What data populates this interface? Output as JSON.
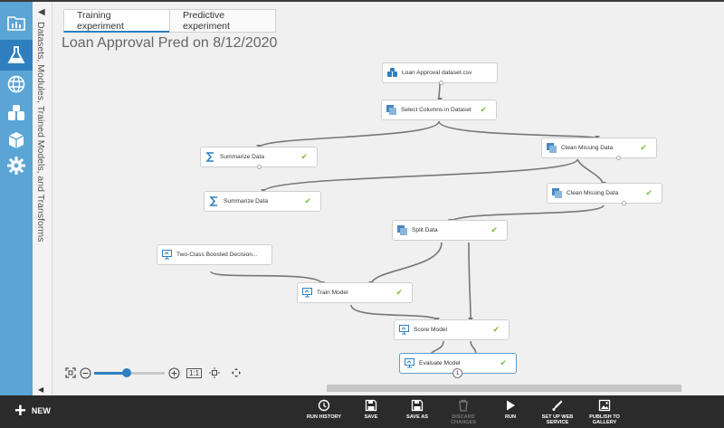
{
  "tabs": [
    {
      "label": "Training experiment",
      "active": true
    },
    {
      "label": "Predictive experiment",
      "active": false
    }
  ],
  "palette_label": "Datasets, Modules, Trained Models, and Transforms",
  "title": "Loan Approval Pred on 8/12/2020",
  "nodes": {
    "dataset": {
      "label": "Loan Approval dataset.csv",
      "icon": "dataset-icon"
    },
    "select_columns": {
      "label": "Select Columns in Dataset",
      "icon": "module-icon"
    },
    "summarize_1": {
      "label": "Summarize Data",
      "icon": "sigma-icon"
    },
    "clean_1": {
      "label": "Clean Missing Data",
      "icon": "module-icon"
    },
    "summarize_2": {
      "label": "Summarize Data",
      "icon": "sigma-icon"
    },
    "clean_2": {
      "label": "Clean Missing Data",
      "icon": "module-icon"
    },
    "split": {
      "label": "Split Data",
      "icon": "module-icon"
    },
    "boosted": {
      "label": "Two-Class Boosted Decision...",
      "icon": "model-icon"
    },
    "train": {
      "label": "Train Model",
      "icon": "model-icon"
    },
    "score": {
      "label": "Score Model",
      "icon": "model-icon"
    },
    "evaluate": {
      "label": "Evaluate Model",
      "icon": "model-icon",
      "port_badge": "1"
    }
  },
  "zoom": {
    "level": 0.46,
    "ratio_label": "1:1"
  },
  "toolbar": {
    "new_label": "NEW",
    "items": [
      {
        "label": "RUN HISTORY",
        "icon": "clock-icon",
        "enabled": true
      },
      {
        "label": "SAVE",
        "icon": "save-icon",
        "enabled": true
      },
      {
        "label": "SAVE AS",
        "icon": "save-as-icon",
        "enabled": true
      },
      {
        "label": "DISCARD CHANGES",
        "icon": "trash-icon",
        "enabled": false
      },
      {
        "label": "RUN",
        "icon": "play-icon",
        "enabled": true
      },
      {
        "label": "SET UP WEB SERVICE",
        "icon": "web-service-icon",
        "enabled": true
      },
      {
        "label": "PUBLISH TO GALLERY",
        "icon": "gallery-icon",
        "enabled": true
      }
    ]
  },
  "colors": {
    "nav": "#5ba5d6",
    "nav_active": "#2f7fbf",
    "check": "#7dba30",
    "accent": "#2f7fbf"
  }
}
